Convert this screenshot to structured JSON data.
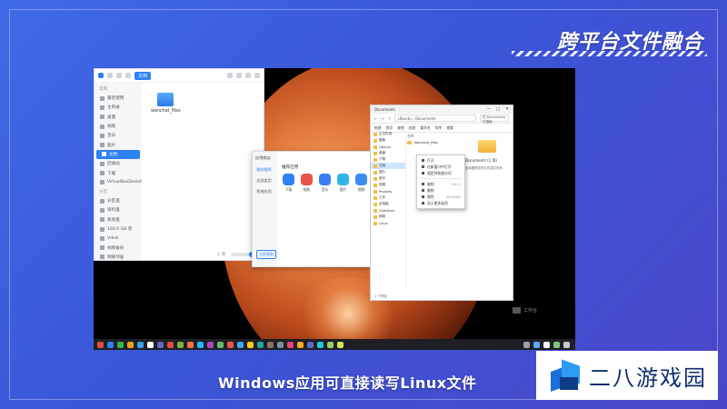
{
  "headline": "跨平台文件融合",
  "caption": "Windows应用可直接读写Linux文件",
  "brand": {
    "text": "二八游戏园",
    "logo_icon": "cube-logo-icon"
  },
  "colors": {
    "background": "#3f6ae6",
    "accent": "#2d82f5",
    "brand_text": "#0e2f6e"
  },
  "linux_fm": {
    "path_chip": "文档",
    "sidebar_group": "常用",
    "sidebar_items": [
      {
        "label": "最近使用",
        "icon": "clock-icon"
      },
      {
        "label": "主目录",
        "icon": "home-icon"
      },
      {
        "label": "桌面",
        "icon": "desktop-icon"
      },
      {
        "label": "视频",
        "icon": "video-icon"
      },
      {
        "label": "音乐",
        "icon": "music-icon"
      },
      {
        "label": "图片",
        "icon": "image-icon"
      },
      {
        "label": "文档",
        "icon": "document-icon",
        "active": true
      },
      {
        "label": "回收站",
        "icon": "trash-icon"
      },
      {
        "label": "下载",
        "icon": "download-icon"
      },
      {
        "label": "VirtualBoxDockit",
        "icon": "folder-icon"
      }
    ],
    "sidebar_group2": "分区",
    "sidebar_items2": [
      {
        "label": "分区盘",
        "icon": "disk-icon"
      },
      {
        "label": "资料盘",
        "icon": "disk-icon"
      },
      {
        "label": "系统盘",
        "icon": "disk-icon"
      },
      {
        "label": "160.0 GB 卷",
        "icon": "disk-icon"
      },
      {
        "label": "Vdisk",
        "icon": "disk-icon"
      },
      {
        "label": "视频备份",
        "icon": "disk-icon"
      },
      {
        "label": "网络邻居",
        "icon": "network-icon"
      }
    ],
    "files": [
      {
        "label": "wanchat_files"
      }
    ],
    "status": "1 项"
  },
  "appstore": {
    "title": "应用商店",
    "nav": [
      "我的推荐",
      "全部类型",
      "系统应用"
    ],
    "button": "立即获取",
    "heading": "推荐应用",
    "apps": [
      {
        "label": "下载",
        "color": "#2d82f5"
      },
      {
        "label": "相机",
        "color": "#e8534b"
      },
      {
        "label": "音乐",
        "color": "#3a7df0"
      },
      {
        "label": "图片",
        "color": "#2fb4e8"
      },
      {
        "label": "视频",
        "color": "#3c8df2"
      }
    ]
  },
  "winexp": {
    "title": "Documents",
    "controls": [
      "—",
      "□",
      "✕"
    ],
    "address": [
      "Ubuntu",
      "Documents"
    ],
    "search_placeholder": "在 Documents 中搜索",
    "toolbar": [
      "新建",
      "剪切",
      "复制",
      "粘贴",
      "重命名",
      "排序",
      "查看"
    ],
    "nav_items": [
      {
        "label": "主文件夹"
      },
      {
        "label": "图库"
      },
      {
        "label": "Ubuntu"
      },
      {
        "label": "桌面"
      },
      {
        "label": "下载"
      },
      {
        "label": "文档",
        "selected": true
      },
      {
        "label": "图片"
      },
      {
        "label": "音乐"
      },
      {
        "label": "视频"
      },
      {
        "label": "Projects"
      },
      {
        "label": "工作"
      },
      {
        "label": "此电脑"
      },
      {
        "label": "OneDrive"
      },
      {
        "label": "网络"
      },
      {
        "label": "Linux"
      }
    ],
    "list_header": "名称",
    "list_rows": [
      "wanchat_files"
    ],
    "preview_title": "Documents (1 项)",
    "preview_desc": "选择要预览的文件或文件夹。",
    "status": "1 个项目"
  },
  "context_menu": [
    {
      "label": "打开",
      "icon": "open-icon"
    },
    {
      "label": "在新窗口中打开",
      "icon": "window-icon"
    },
    {
      "label": "固定到快速访问",
      "icon": "pin-icon"
    },
    {
      "sep": true
    },
    {
      "label": "复制",
      "icon": "copy-icon",
      "shortcut": "Ctrl+C"
    },
    {
      "label": "删除",
      "icon": "delete-icon"
    },
    {
      "label": "属性",
      "icon": "info-icon",
      "shortcut": "Alt+Enter"
    },
    {
      "label": "显示更多选项",
      "icon": "more-icon"
    }
  ],
  "taskbar_icons": [
    "#e24c3c",
    "#2d82f5",
    "#35b54a",
    "#f0a020",
    "#3aa0e8",
    "#ffffff",
    "#5c6bc0",
    "#e24c3c",
    "#7cb342",
    "#ff7043",
    "#29b6f6",
    "#ab47bc",
    "#66bb6a",
    "#ef5350",
    "#42a5f5",
    "#ffca28",
    "#26a69a",
    "#8d6e63",
    "#78909c",
    "#ec407a",
    "#ffa726",
    "#5c6bc0",
    "#26c6da",
    "#9ccc65",
    "#d4e157"
  ],
  "tray_icons": [
    "#9aa3ad",
    "#5aa9ff",
    "#ffffff",
    "#7fc97f",
    "#cccccc"
  ],
  "watermark": "工作台"
}
